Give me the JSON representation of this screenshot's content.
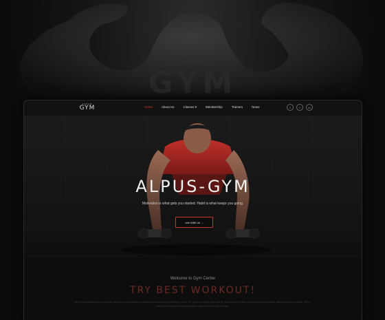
{
  "background": {
    "word": "GYM"
  },
  "nav": {
    "logo_top": "ALPUS",
    "logo_main": "GYM",
    "menu": [
      {
        "label": "Home",
        "active": true
      },
      {
        "label": "About Us",
        "active": false
      },
      {
        "label": "Classes ▾",
        "active": false
      },
      {
        "label": "Membership",
        "active": false
      },
      {
        "label": "Trainers",
        "active": false
      },
      {
        "label": "News",
        "active": false
      }
    ],
    "socials": [
      {
        "icon": "twitter-icon",
        "glyph": "t"
      },
      {
        "icon": "facebook-icon",
        "glyph": "f"
      },
      {
        "icon": "linkedin-icon",
        "glyph": "in"
      }
    ]
  },
  "hero": {
    "title": "ALPUS-GYM",
    "subtitle": "Motivation is what gets you started. Habit is what keeps you going.",
    "button": "Join With Us →"
  },
  "welcome": {
    "subtitle": "Welcome to Gym Center",
    "title": "TRY BEST WORKOUT!",
    "text": "Sed ut perspiciatis unde omnis iste natus error sit voluptatem accusantium doloremque laudantium, totam rem aperiam, eaque ipsa quae ab illo inventore veritatis et quasi architecto beatae vitae dicta sunt explicabo. Nemo enim ipsam voluptatem quia voluptas sit aspernatur aut odit aut fugit."
  },
  "colors": {
    "accent": "#d33a28",
    "background": "#0a0a0a"
  }
}
